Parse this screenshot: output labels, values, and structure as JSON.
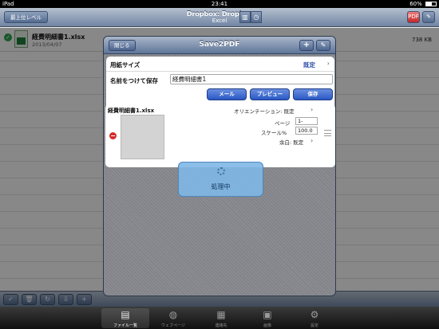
{
  "status_bar": {
    "carrier": "iPad",
    "time": "23:41",
    "battery": "60%",
    "battery_level": 0.6
  },
  "nav": {
    "back_label": "最上位レベル",
    "title": "Dropbox: Dropbox",
    "subtitle": "Excel"
  },
  "files": [
    {
      "name": "経費明細書1.xlsx",
      "date": "2013/04/07",
      "size": "738 KB"
    }
  ],
  "modal": {
    "close_label": "閉じる",
    "title": "Save2PDF",
    "paper_size_label": "用紙サイズ",
    "paper_size_value": "既定",
    "save_as_label": "名前をつけて保存",
    "save_as_value": "経費明細書1",
    "mail_label": "メール",
    "preview_label": "プレビュー",
    "save_label": "保存",
    "file": {
      "name": "経費明細書1.xlsx",
      "orientation_label": "オリエンテーション: 既定",
      "page_label": "ページ",
      "page_value": "1-",
      "scale_label": "スケール%",
      "scale_value": "100.0",
      "margin_label": "余白: 既定"
    },
    "processing_label": "処理中"
  },
  "tabs": [
    {
      "label": "ファイル一覧",
      "icon": "file-list-icon",
      "active": true
    },
    {
      "label": "ウェブページ",
      "icon": "globe-icon",
      "active": false
    },
    {
      "label": "連絡先",
      "icon": "contacts-icon",
      "active": false
    },
    {
      "label": "画像",
      "icon": "photos-icon",
      "active": false
    },
    {
      "label": "設定",
      "icon": "gear-icon",
      "active": false
    }
  ]
}
